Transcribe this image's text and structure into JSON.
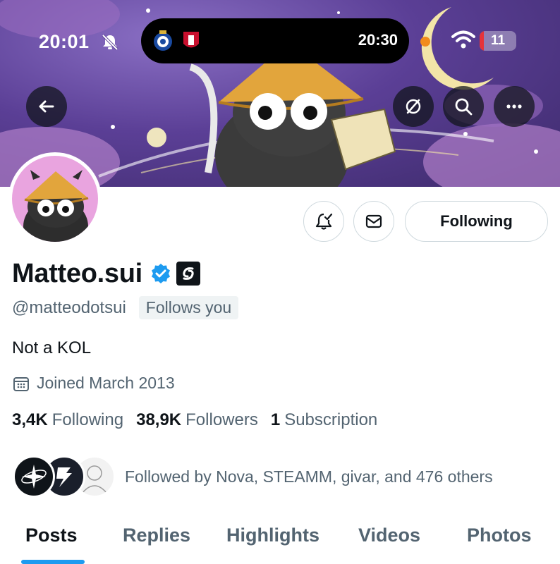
{
  "status_bar": {
    "time": "20:01",
    "island_time": "20:30",
    "battery_level": 11,
    "battery_text": "11",
    "icons": [
      "bell-off-icon",
      "wifi-icon",
      "battery-icon"
    ]
  },
  "header": {
    "icons": [
      "back-arrow-icon",
      "no-retweet-icon",
      "search-icon",
      "more-icon"
    ]
  },
  "profile": {
    "display_name": "Matteo.sui",
    "handle": "@matteodotsui",
    "follows_you": "Follows you",
    "bio": "Not a KOL",
    "joined": "Joined March 2013"
  },
  "actions": {
    "following_label": "Following",
    "icons": [
      "bell-check-icon",
      "mail-icon"
    ]
  },
  "stats": [
    {
      "value": "3,4K",
      "label": "Following"
    },
    {
      "value": "38,9K",
      "label": "Followers"
    },
    {
      "value": "1",
      "label": "Subscription"
    }
  ],
  "followed_by": "Followed by Nova, STEAMM, givar, and 476 others",
  "tabs": [
    {
      "label": "Posts",
      "active": true
    },
    {
      "label": "Replies",
      "active": false
    },
    {
      "label": "Highlights",
      "active": false
    },
    {
      "label": "Videos",
      "active": false
    },
    {
      "label": "Photos",
      "active": false
    }
  ],
  "colors": {
    "accent": "#1d9bf0",
    "text_primary": "#0f1419",
    "text_secondary": "#536471",
    "battery_low": "#e5333a",
    "avatar_bg": "#e9a4df"
  }
}
